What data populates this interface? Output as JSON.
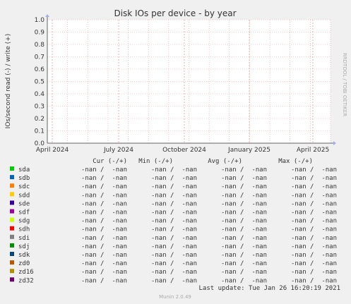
{
  "chart_data": {
    "type": "line",
    "title": "Disk IOs per device - by year",
    "ylabel": "IOs/second read (-) / write (+)",
    "side_label": "RRDTOOL / TOBI OETIKER",
    "yticks": [
      "0.0",
      "0.1",
      "0.2",
      "0.3",
      "0.4",
      "0.5",
      "0.6",
      "0.7",
      "0.8",
      "0.9",
      "1.0"
    ],
    "ylim": [
      0,
      1
    ],
    "xticks": [
      "April 2024",
      "July 2024",
      "October 2024",
      "January 2025",
      "April 2025"
    ],
    "grid": true,
    "legend_headers": [
      "Cur (-/+)",
      "Min (-/+)",
      "Avg (-/+)",
      "Max (-/+)"
    ],
    "series": [
      {
        "name": "sda",
        "color": "#00cc00",
        "cur": "-nan /  -nan",
        "min": "-nan /  -nan",
        "avg": "-nan /  -nan",
        "max": "-nan /  -nan"
      },
      {
        "name": "sdb",
        "color": "#0066b3",
        "cur": "-nan /  -nan",
        "min": "-nan /  -nan",
        "avg": "-nan /  -nan",
        "max": "-nan /  -nan"
      },
      {
        "name": "sdc",
        "color": "#ff8000",
        "cur": "-nan /  -nan",
        "min": "-nan /  -nan",
        "avg": "-nan /  -nan",
        "max": "-nan /  -nan"
      },
      {
        "name": "sdd",
        "color": "#ffcc00",
        "cur": "-nan /  -nan",
        "min": "-nan /  -nan",
        "avg": "-nan /  -nan",
        "max": "-nan /  -nan"
      },
      {
        "name": "sde",
        "color": "#330099",
        "cur": "-nan /  -nan",
        "min": "-nan /  -nan",
        "avg": "-nan /  -nan",
        "max": "-nan /  -nan"
      },
      {
        "name": "sdf",
        "color": "#990099",
        "cur": "-nan /  -nan",
        "min": "-nan /  -nan",
        "avg": "-nan /  -nan",
        "max": "-nan /  -nan"
      },
      {
        "name": "sdg",
        "color": "#ccff00",
        "cur": "-nan /  -nan",
        "min": "-nan /  -nan",
        "avg": "-nan /  -nan",
        "max": "-nan /  -nan"
      },
      {
        "name": "sdh",
        "color": "#ff0000",
        "cur": "-nan /  -nan",
        "min": "-nan /  -nan",
        "avg": "-nan /  -nan",
        "max": "-nan /  -nan"
      },
      {
        "name": "sdi",
        "color": "#808080",
        "cur": "-nan /  -nan",
        "min": "-nan /  -nan",
        "avg": "-nan /  -nan",
        "max": "-nan /  -nan"
      },
      {
        "name": "sdj",
        "color": "#008f00",
        "cur": "-nan /  -nan",
        "min": "-nan /  -nan",
        "avg": "-nan /  -nan",
        "max": "-nan /  -nan"
      },
      {
        "name": "sdk",
        "color": "#00487d",
        "cur": "-nan /  -nan",
        "min": "-nan /  -nan",
        "avg": "-nan /  -nan",
        "max": "-nan /  -nan"
      },
      {
        "name": "zd0",
        "color": "#b35a00",
        "cur": "-nan /  -nan",
        "min": "-nan /  -nan",
        "avg": "-nan /  -nan",
        "max": "-nan /  -nan"
      },
      {
        "name": "zd16",
        "color": "#b38f00",
        "cur": "-nan /  -nan",
        "min": "-nan /  -nan",
        "avg": "-nan /  -nan",
        "max": "-nan /  -nan"
      },
      {
        "name": "zd32",
        "color": "#6b006b",
        "cur": "-nan /  -nan",
        "min": "-nan /  -nan",
        "avg": "-nan /  -nan",
        "max": "-nan /  -nan"
      }
    ],
    "last_update": "Last update: Tue Jan 26 16:20:19 2021",
    "footer": "Munin 2.0.49"
  }
}
